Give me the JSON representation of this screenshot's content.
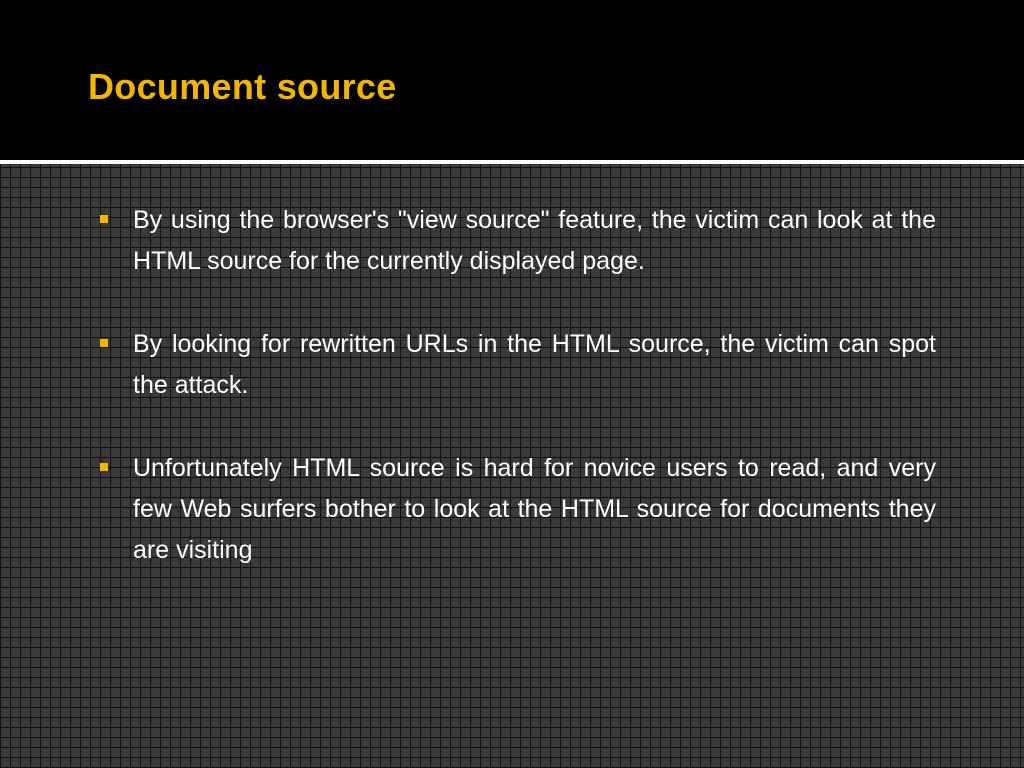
{
  "colors": {
    "title": "#f2b500",
    "bullet_marker": "#f2b500",
    "body_text": "#ffffff",
    "background": "#000000"
  },
  "slide": {
    "title": "Document source",
    "bullets": [
      {
        "text": "By using the browser's \"view source\" feature, the victim can look at the HTML source for the currently displayed page."
      },
      {
        "text": "By looking for rewritten URLs in the HTML source, the victim can spot the attack."
      },
      {
        "text": "Unfortunately  HTML source is hard for novice users to read, and very few Web surfers bother to look at the HTML source for documents they are visiting"
      }
    ]
  }
}
